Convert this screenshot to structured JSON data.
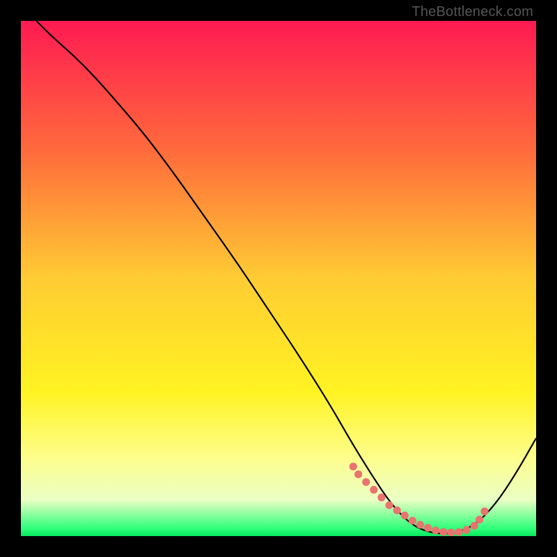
{
  "watermark": "TheBottleneck.com",
  "chart_data": {
    "type": "line",
    "title": "",
    "xlabel": "",
    "ylabel": "",
    "xlim": [
      0,
      100
    ],
    "ylim": [
      0,
      100
    ],
    "grid": false,
    "legend": false,
    "gradient_stops": [
      {
        "offset": 0.0,
        "color": "#ff1a52"
      },
      {
        "offset": 0.25,
        "color": "#ff6a3c"
      },
      {
        "offset": 0.5,
        "color": "#ffcc33"
      },
      {
        "offset": 0.72,
        "color": "#fff322"
      },
      {
        "offset": 0.85,
        "color": "#fdfe8e"
      },
      {
        "offset": 0.93,
        "color": "#eaffc4"
      },
      {
        "offset": 0.985,
        "color": "#2fff7a"
      },
      {
        "offset": 1.0,
        "color": "#08e85e"
      }
    ],
    "series": [
      {
        "name": "curve",
        "color": "#000000",
        "width": 2.2,
        "x": [
          3,
          6,
          10,
          14,
          18,
          24,
          30,
          36,
          42,
          48,
          54,
          60,
          64,
          68,
          72,
          76,
          80,
          84,
          88,
          92,
          96,
          100
        ],
        "y": [
          100,
          97,
          93.5,
          89.5,
          85,
          78,
          70,
          61.5,
          53,
          44,
          35,
          25.5,
          18.5,
          12,
          6,
          2,
          0.5,
          0.5,
          2,
          6,
          12,
          19
        ]
      }
    ],
    "markers": {
      "name": "dots",
      "color": "#e9736f",
      "radius": 5.6,
      "x": [
        64.5,
        65.5,
        67,
        68.5,
        70,
        71.5,
        73,
        74.5,
        76,
        77.5,
        79,
        80.5,
        82,
        83.5,
        85,
        86.5,
        88,
        89,
        90
      ],
      "y": [
        13.5,
        12,
        10.5,
        9,
        7.5,
        6,
        5,
        4,
        3,
        2.2,
        1.6,
        1.1,
        0.8,
        0.7,
        0.8,
        1.2,
        2,
        3.2,
        4.8
      ]
    }
  }
}
